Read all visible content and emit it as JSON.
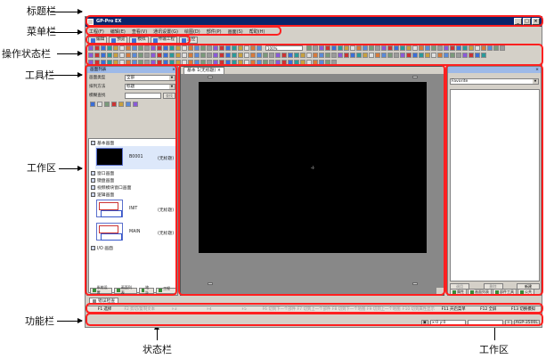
{
  "annotations": {
    "title_bar": "标题栏",
    "menu_bar": "菜单栏",
    "mode_bar": "操作状态栏",
    "toolbar": "工具栏",
    "work_area_left": "工作区",
    "function_bar": "功能栏",
    "status_bar": "状态栏",
    "work_area_right": "工作区"
  },
  "window": {
    "title": "GP-Pro EX",
    "min": "_",
    "max": "□",
    "close": "×"
  },
  "menu": [
    "工程(F)",
    "编辑(E)",
    "查看(V)",
    "通讯设置(G)",
    "绘图(D)",
    "部件(P)",
    "画面(S)",
    "帮助(H)"
  ],
  "modes": [
    "编辑",
    "预览",
    "模拟",
    "传输工程",
    "监控"
  ],
  "toolbar": {
    "zoom": "100%"
  },
  "left_panel": {
    "title": "画面列表",
    "close": "×",
    "type_label": "画面类型",
    "type_value": "全部",
    "sort_label": "排列方法",
    "sort_value": "标题",
    "search_label": "模糊查找",
    "search_button": "查找",
    "tree": {
      "base": "基本画面",
      "base_screens": [
        {
          "num": "B0001",
          "name": "(无标题)"
        }
      ],
      "window": "窗口画面",
      "keypad": "键盘画面",
      "video": "视频模块窗口画面",
      "logic": "逻辑画面",
      "logic_screens": [
        {
          "num": "INIT",
          "name": "(无标题)"
        },
        {
          "num": "MAIN",
          "name": "(无标题)"
        }
      ],
      "io": "I/O 画面"
    },
    "tabs": [
      "系统设置",
      "画面列表",
      "地址",
      "工程 ..."
    ]
  },
  "editor": {
    "tab": "基本 1(无标题)",
    "tab_close": "×"
  },
  "right_panel": {
    "title": "",
    "dropdown": "Favorite",
    "btn_left": "调用",
    "btn_mid": "删除",
    "btn_main": "新建",
    "tabs": [
      "属性",
      "画面列表",
      "部件工具",
      "公共"
    ]
  },
  "function_area": {
    "tab": "错误检查",
    "keys": [
      "F1 选择",
      "F2 剪切/复制文本",
      "F3",
      "F4",
      "F5",
      "F6 切到下一个部件",
      "F7 切到上一个部件",
      "F8 切到下一个地图",
      "F9 切到上一个地图",
      "F10 切到属性显示",
      "F11 开启菜单",
      "F12 全屏",
      "F13 切换模拟"
    ],
    "active": [
      0,
      10,
      11,
      12
    ]
  },
  "status": {
    "coords": "x:0  y:0",
    "model": "AGP-3500L"
  }
}
